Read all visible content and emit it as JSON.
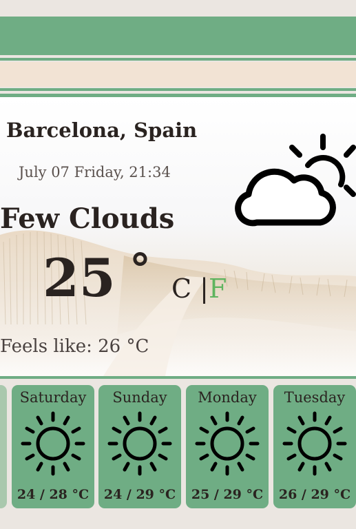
{
  "location": {
    "city": "Barcelona, Spain",
    "datetime": "July 07 Friday, 21:34"
  },
  "current": {
    "condition": "Few Clouds",
    "temperature": "25",
    "degree_symbol": "°",
    "unit_c": "C",
    "unit_separator": "|",
    "unit_f": "F",
    "feels_like": "Feels like: 26 °C",
    "icon": "few-clouds-icon"
  },
  "forecast": [
    {
      "day": "Saturday",
      "range": "24 / 28 °C",
      "icon": "sun-icon"
    },
    {
      "day": "Sunday",
      "range": "24 / 29 °C",
      "icon": "sun-icon"
    },
    {
      "day": "Monday",
      "range": "25 / 29 °C",
      "icon": "sun-icon"
    },
    {
      "day": "Tuesday",
      "range": "26 / 29 °C",
      "icon": "sun-icon"
    }
  ],
  "colors": {
    "accent": "#6fad84",
    "cream": "#f2e3d4",
    "fahrenheit": "#5fb45f",
    "background": "#ebe6e1"
  }
}
